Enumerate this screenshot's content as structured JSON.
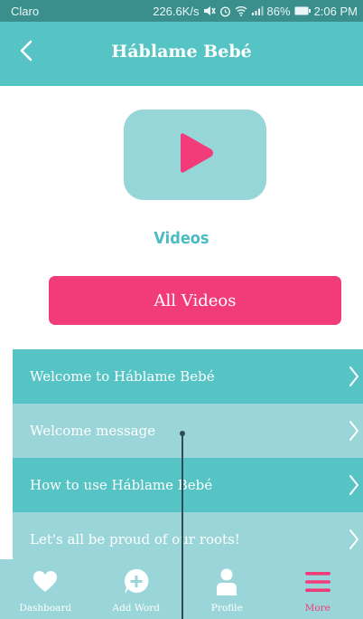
{
  "status_bar": {
    "carrier": "Claro",
    "speed": "226.6K/s",
    "battery": "86%",
    "time": "2:06 PM"
  },
  "header": {
    "title": "Háblame Bebé",
    "back_icon": "chevron-left-icon"
  },
  "section": {
    "title": "Videos",
    "all_videos_label": "All Videos"
  },
  "videos": [
    {
      "label": "Welcome to Háblame Bebé"
    },
    {
      "label": "Welcome message"
    },
    {
      "label": "How to use Háblame Bebé"
    },
    {
      "label": "Let's all be proud of our roots!"
    }
  ],
  "bottom_nav": {
    "tabs": [
      {
        "label": "Dashboard",
        "icon": "heart-icon"
      },
      {
        "label": "Add Word",
        "icon": "plus-circle-icon"
      },
      {
        "label": "Profile",
        "icon": "person-icon"
      },
      {
        "label": "More",
        "icon": "menu-icon",
        "active": true
      }
    ]
  },
  "colors": {
    "primary": "#56c4c4",
    "light": "#9ad6d9",
    "accent": "#f23c7a",
    "status_bar": "#3a8f8c"
  }
}
